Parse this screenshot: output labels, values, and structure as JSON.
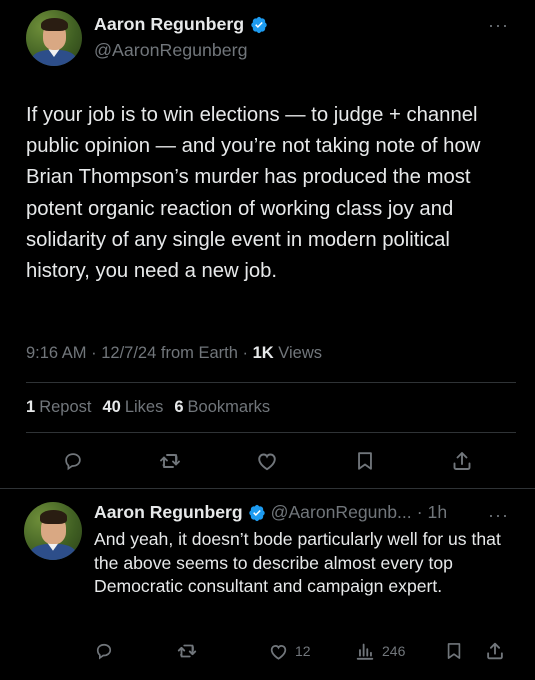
{
  "main_tweet": {
    "author_name": "Aaron Regunberg",
    "author_handle": "@AaronRegunberg",
    "text": "If your job is to win elections — to judge + channel public opinion — and you’re not taking note of how Brian Thompson’s murder has produced the most potent organic reaction of working class joy and solidarity of any single event in modern political history, you need a new job.",
    "time": "9:16 AM",
    "date": "12/7/24",
    "source": "from Earth",
    "views_count": "1K",
    "views_label": "Views",
    "reposts_count": "1",
    "reposts_label": "Repost",
    "likes_count": "40",
    "likes_label": "Likes",
    "bookmarks_count": "6",
    "bookmarks_label": "Bookmarks"
  },
  "reply_tweet": {
    "author_name": "Aaron Regunberg",
    "author_handle": "@AaronRegunb...",
    "time_ago": "1h",
    "text": "And yeah, it doesn’t bode particularly well for us that the above seems to describe almost every top Democratic consultant and campaign expert.",
    "likes_count": "12",
    "views_count": "246"
  },
  "colors": {
    "background": "#000000",
    "text": "#e7e9ea",
    "muted": "#71767b",
    "verified": "#1d9bf0",
    "divider": "#2f3336"
  },
  "icons": [
    "reply-icon",
    "repost-icon",
    "like-icon",
    "bookmark-icon",
    "share-icon",
    "views-icon",
    "verified-badge-icon",
    "more-icon"
  ]
}
